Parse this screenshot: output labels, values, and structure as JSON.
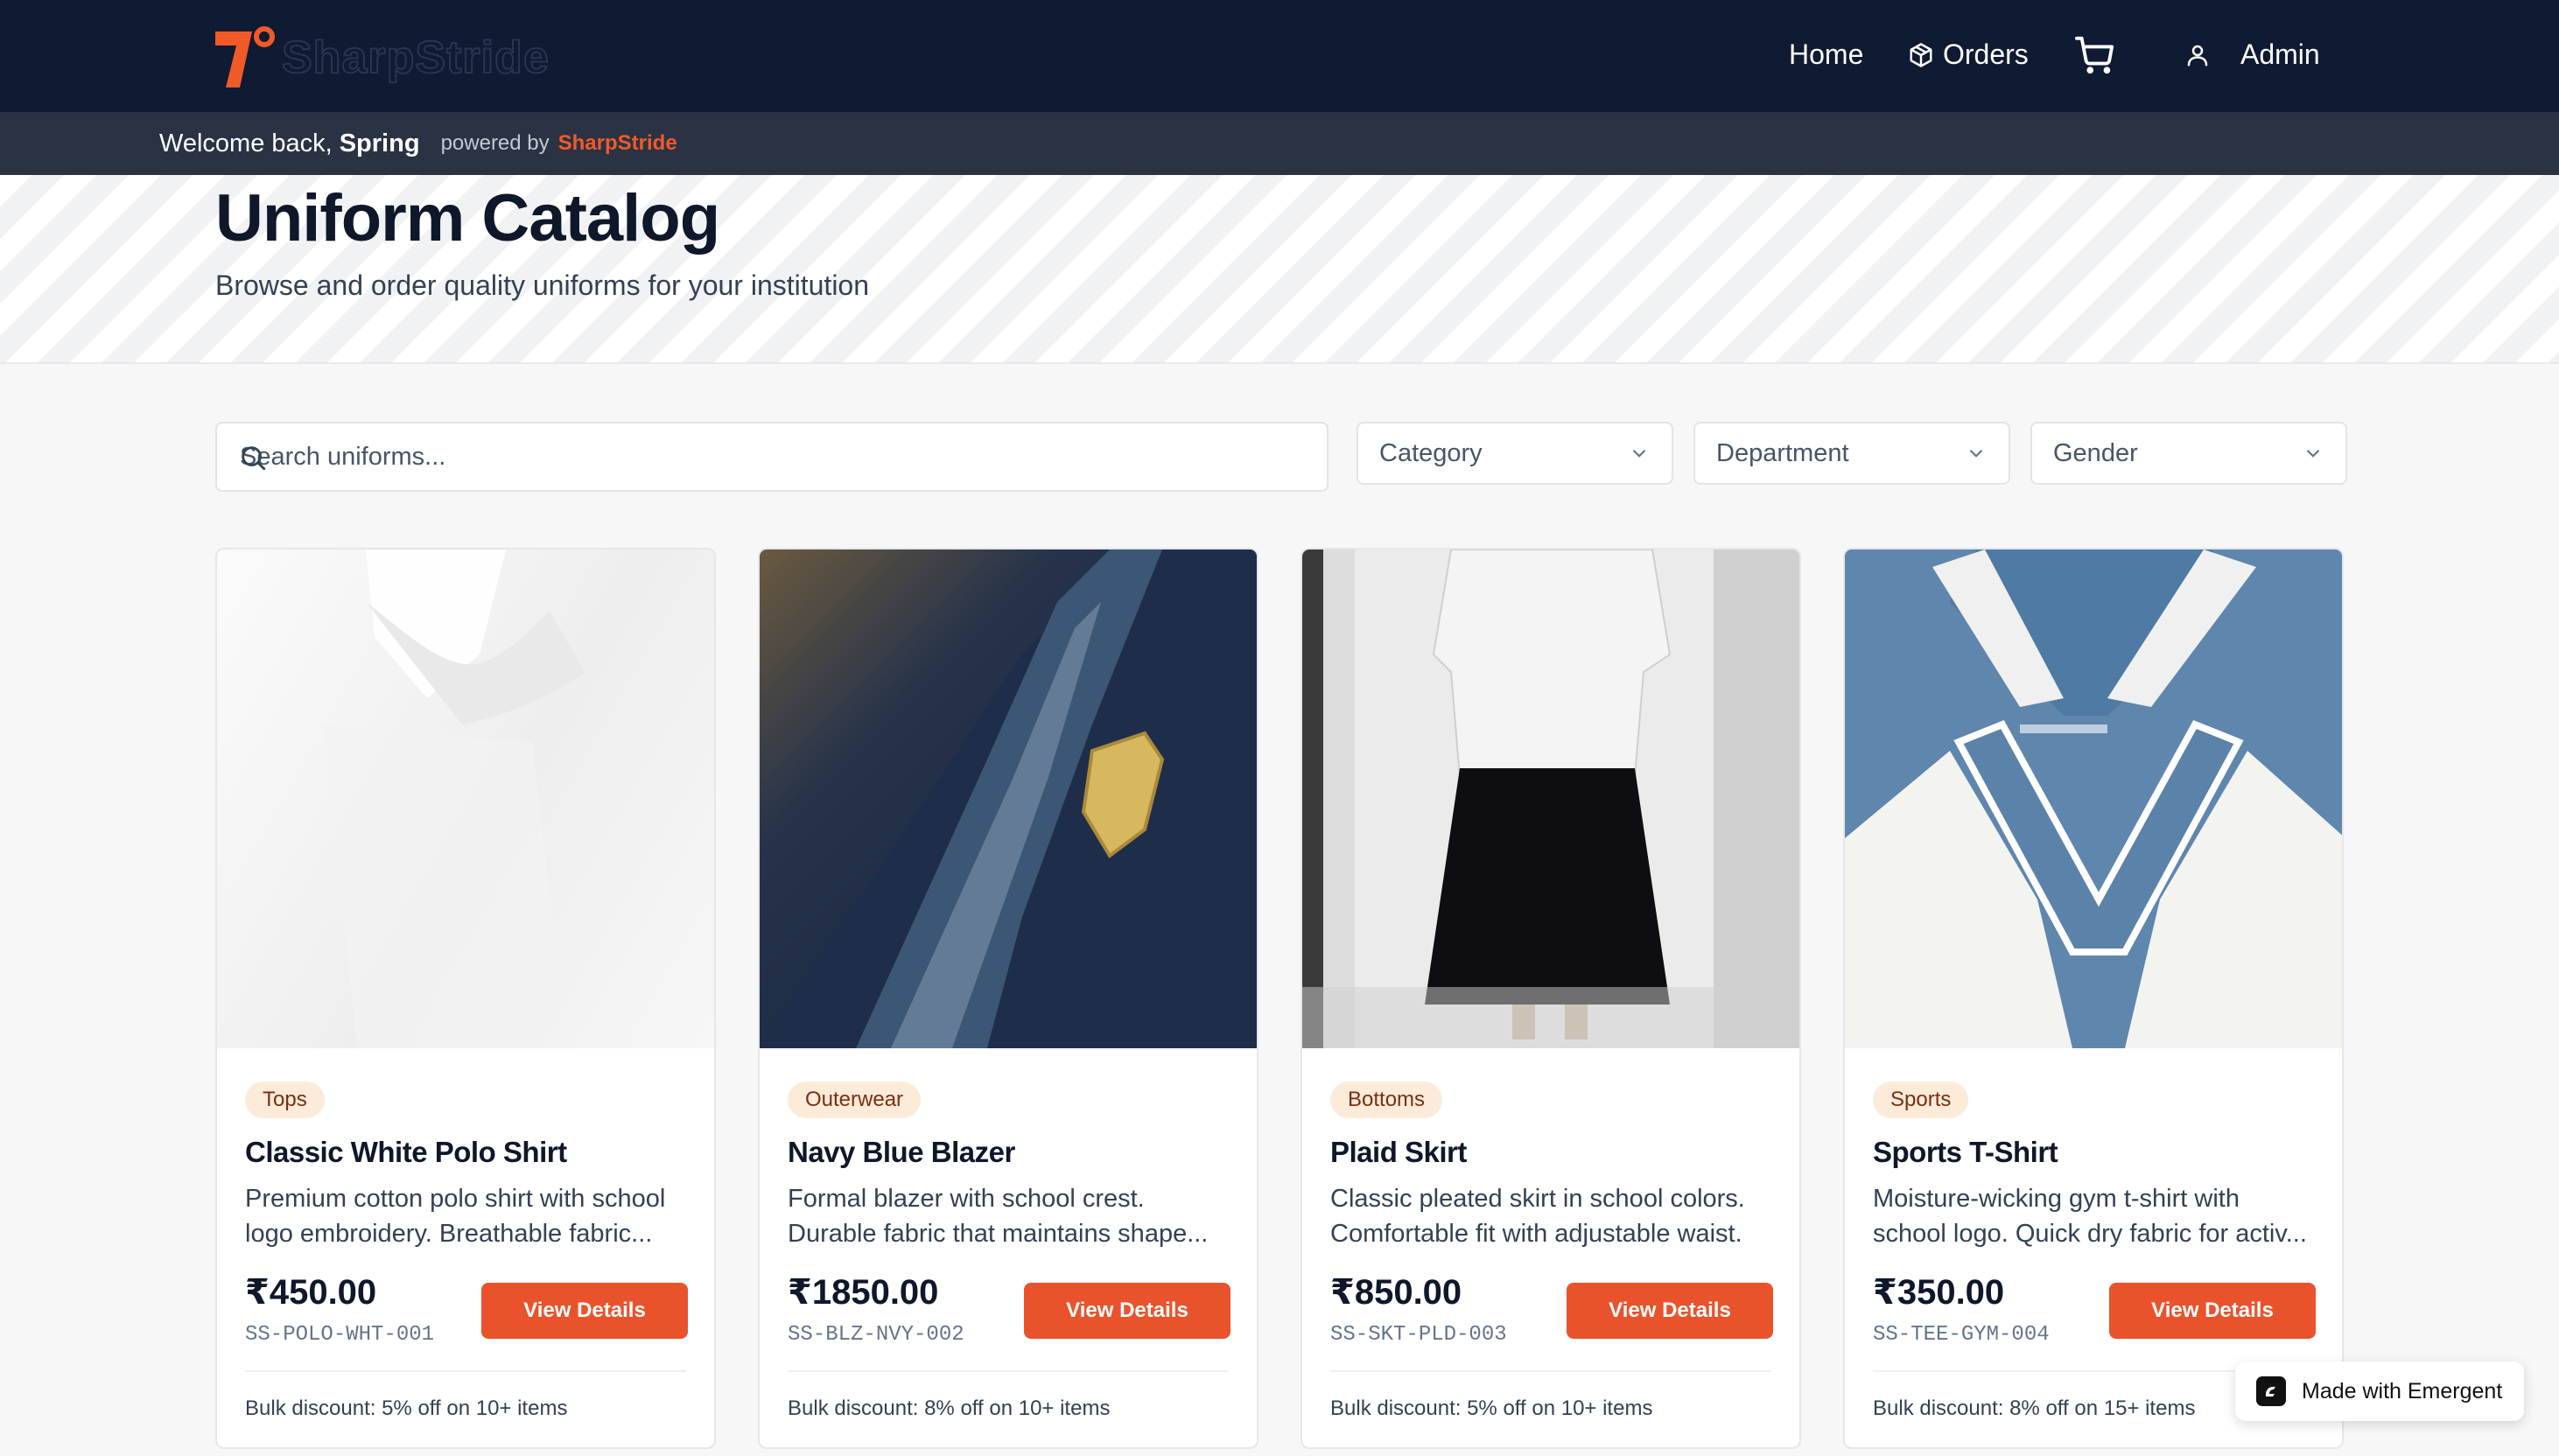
{
  "brand": {
    "logo_text": "SharpStride",
    "accent": "#f05a28"
  },
  "nav": {
    "home": "Home",
    "orders": "Orders",
    "admin": "Admin"
  },
  "welcome": {
    "prefix": "Welcome back,",
    "name": "Spring",
    "powered_by": "powered by",
    "brand": "SharpStride"
  },
  "hero": {
    "title": "Uniform Catalog",
    "subtitle": "Browse and order quality uniforms for your institution"
  },
  "filters": {
    "search_placeholder": "Search uniforms...",
    "category": "Category",
    "department": "Department",
    "gender": "Gender"
  },
  "products": [
    {
      "category": "Tops",
      "name": "Classic White Polo Shirt",
      "desc1": "Premium cotton polo shirt with school",
      "desc2": "logo embroidery. Breathable fabric...",
      "price": "₹450.00",
      "sku": "SS-POLO-WHT-001",
      "button": "View Details",
      "bulk": "Bulk discount: 5% off on 10+ items"
    },
    {
      "category": "Outerwear",
      "name": "Navy Blue Blazer",
      "desc1": "Formal blazer with school crest.",
      "desc2": "Durable fabric that maintains shape...",
      "price": "₹1850.00",
      "sku": "SS-BLZ-NVY-002",
      "button": "View Details",
      "bulk": "Bulk discount: 8% off on 10+ items"
    },
    {
      "category": "Bottoms",
      "name": "Plaid Skirt",
      "desc1": "Classic pleated skirt in school colors.",
      "desc2": "Comfortable fit with adjustable waist.",
      "price": "₹850.00",
      "sku": "SS-SKT-PLD-003",
      "button": "View Details",
      "bulk": "Bulk discount: 5% off on 10+ items"
    },
    {
      "category": "Sports",
      "name": "Sports T-Shirt",
      "desc1": "Moisture-wicking gym t-shirt with",
      "desc2": "school logo. Quick dry fabric for activ...",
      "price": "₹350.00",
      "sku": "SS-TEE-GYM-004",
      "button": "View Details",
      "bulk": "Bulk discount: 8% off on 15+ items"
    }
  ],
  "badge": {
    "label": "Made with Emergent"
  }
}
